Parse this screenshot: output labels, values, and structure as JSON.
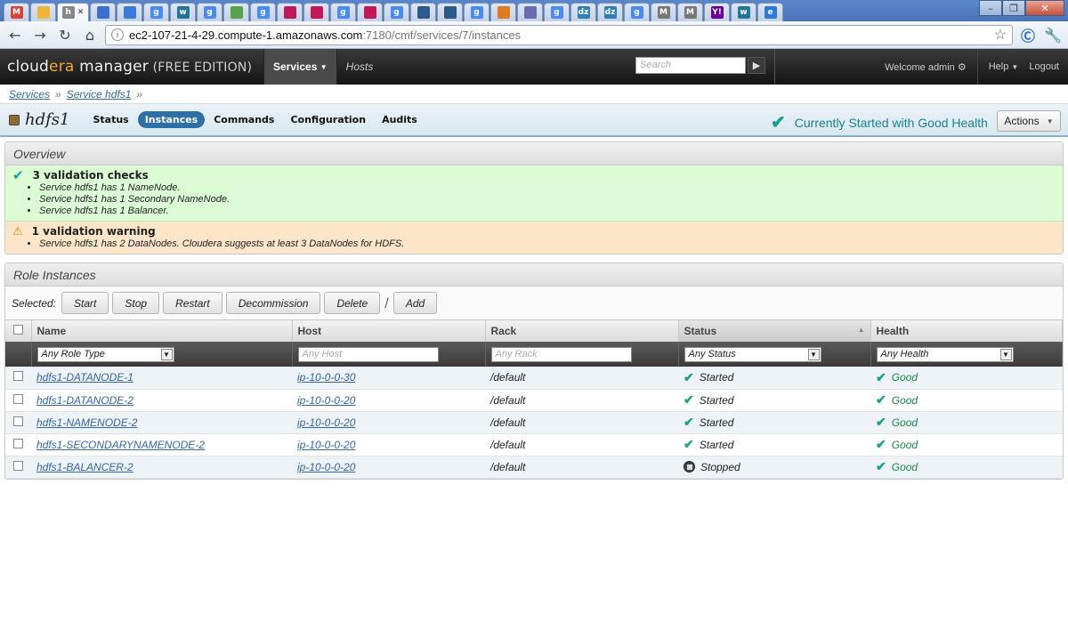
{
  "browser": {
    "tabs": [
      {
        "icon": "gmail-icon",
        "letter": "M",
        "color": "#d44638"
      },
      {
        "icon": "drive-icon",
        "letter": "",
        "color": "#f1b53a"
      },
      {
        "icon": "cloudera-tab-icon",
        "letter": "h",
        "color": "#888888",
        "active": true
      },
      {
        "icon": "doc-icon",
        "letter": "",
        "color": "#3a6fd0"
      },
      {
        "icon": "docs-icon",
        "letter": "",
        "color": "#3a7ad8"
      },
      {
        "icon": "google-icon",
        "letter": "g",
        "color": "#4a8af4"
      },
      {
        "icon": "wordpress-icon",
        "letter": "w",
        "color": "#21759b"
      },
      {
        "icon": "google-icon",
        "letter": "g",
        "color": "#4a8af4"
      },
      {
        "icon": "chat-icon",
        "letter": "",
        "color": "#5aa04a"
      },
      {
        "icon": "google-icon",
        "letter": "g",
        "color": "#4a8af4"
      },
      {
        "icon": "feather-icon",
        "letter": "",
        "color": "#c2185b"
      },
      {
        "icon": "feather-icon",
        "letter": "",
        "color": "#c2185b"
      },
      {
        "icon": "google-icon",
        "letter": "g",
        "color": "#4a8af4"
      },
      {
        "icon": "feather-icon",
        "letter": "",
        "color": "#c2185b"
      },
      {
        "icon": "google-icon",
        "letter": "g",
        "color": "#4a8af4"
      },
      {
        "icon": "globe-icon",
        "letter": "",
        "color": "#2b5a8a"
      },
      {
        "icon": "globe-icon",
        "letter": "",
        "color": "#2b5a8a"
      },
      {
        "icon": "google-icon",
        "letter": "g",
        "color": "#4a8af4"
      },
      {
        "icon": "stack-icon",
        "letter": "",
        "color": "#e07a1f"
      },
      {
        "icon": "calendar-icon",
        "letter": "",
        "color": "#6a6ab0"
      },
      {
        "icon": "google-icon",
        "letter": "g",
        "color": "#4a8af4"
      },
      {
        "icon": "dzone-icon",
        "letter": "dz",
        "color": "#2e7fb8"
      },
      {
        "icon": "dzone-icon",
        "letter": "dz",
        "color": "#2e7fb8"
      },
      {
        "icon": "google-icon",
        "letter": "g",
        "color": "#4a8af4"
      },
      {
        "icon": "mongo-icon",
        "letter": "M",
        "color": "#777777"
      },
      {
        "icon": "mongo-icon",
        "letter": "M",
        "color": "#777777"
      },
      {
        "icon": "yahoo-icon",
        "letter": "Y!",
        "color": "#6b0099"
      },
      {
        "icon": "wordpress-icon",
        "letter": "w",
        "color": "#21759b"
      },
      {
        "icon": "edge-icon",
        "letter": "e",
        "color": "#2b7bd8"
      }
    ],
    "address_host": "ec2-107-21-4-29.compute-1.amazonaws.com",
    "address_path": ":7180/cmf/services/7/instances"
  },
  "header": {
    "logo_main_a": "cloud",
    "logo_main_b": "era",
    "logo_main_c": " manager",
    "logo_edition": " (FREE EDITION)",
    "nav_services": "Services",
    "nav_hosts": "Hosts",
    "search_placeholder": "Search",
    "welcome": "Welcome admin",
    "help": "Help",
    "logout": "Logout"
  },
  "breadcrumb": {
    "items": [
      "Services",
      "Service hdfs1"
    ],
    "separator": "»"
  },
  "service": {
    "name": "hdfs1",
    "tabs": [
      "Status",
      "Instances",
      "Commands",
      "Configuration",
      "Audits"
    ],
    "active_tab": "Instances",
    "health_text": "Currently Started with Good Health",
    "actions_label": "Actions"
  },
  "overview": {
    "title": "Overview",
    "checks_title": "3 validation checks",
    "checks": [
      "Service hdfs1 has 1 NameNode.",
      "Service hdfs1 has 1 Secondary NameNode.",
      "Service hdfs1 has 1 Balancer."
    ],
    "warning_title": "1 validation warning",
    "warnings": [
      "Service hdfs1 has 2 DataNodes. Cloudera suggests at least 3 DataNodes for HDFS."
    ]
  },
  "roles": {
    "title": "Role Instances",
    "selected_label": "Selected:",
    "buttons": [
      "Start",
      "Stop",
      "Restart",
      "Decommission",
      "Delete"
    ],
    "add_label": "Add",
    "columns": [
      "Name",
      "Host",
      "Rack",
      "Status",
      "Health"
    ],
    "filters": {
      "role_type": "Any Role Type",
      "host_placeholder": "Any Host",
      "rack_placeholder": "Any Rack",
      "status": "Any Status",
      "health": "Any Health"
    },
    "rows": [
      {
        "name": "hdfs1-DATANODE-1",
        "host": "ip-10-0-0-30",
        "rack": "/default",
        "status": "Started",
        "health": "Good"
      },
      {
        "name": "hdfs1-DATANODE-2",
        "host": "ip-10-0-0-20",
        "rack": "/default",
        "status": "Started",
        "health": "Good"
      },
      {
        "name": "hdfs1-NAMENODE-2",
        "host": "ip-10-0-0-20",
        "rack": "/default",
        "status": "Started",
        "health": "Good"
      },
      {
        "name": "hdfs1-SECONDARYNAMENODE-2",
        "host": "ip-10-0-0-20",
        "rack": "/default",
        "status": "Started",
        "health": "Good"
      },
      {
        "name": "hdfs1-BALANCER-2",
        "host": "ip-10-0-0-20",
        "rack": "/default",
        "status": "Stopped",
        "health": "Good"
      }
    ]
  }
}
